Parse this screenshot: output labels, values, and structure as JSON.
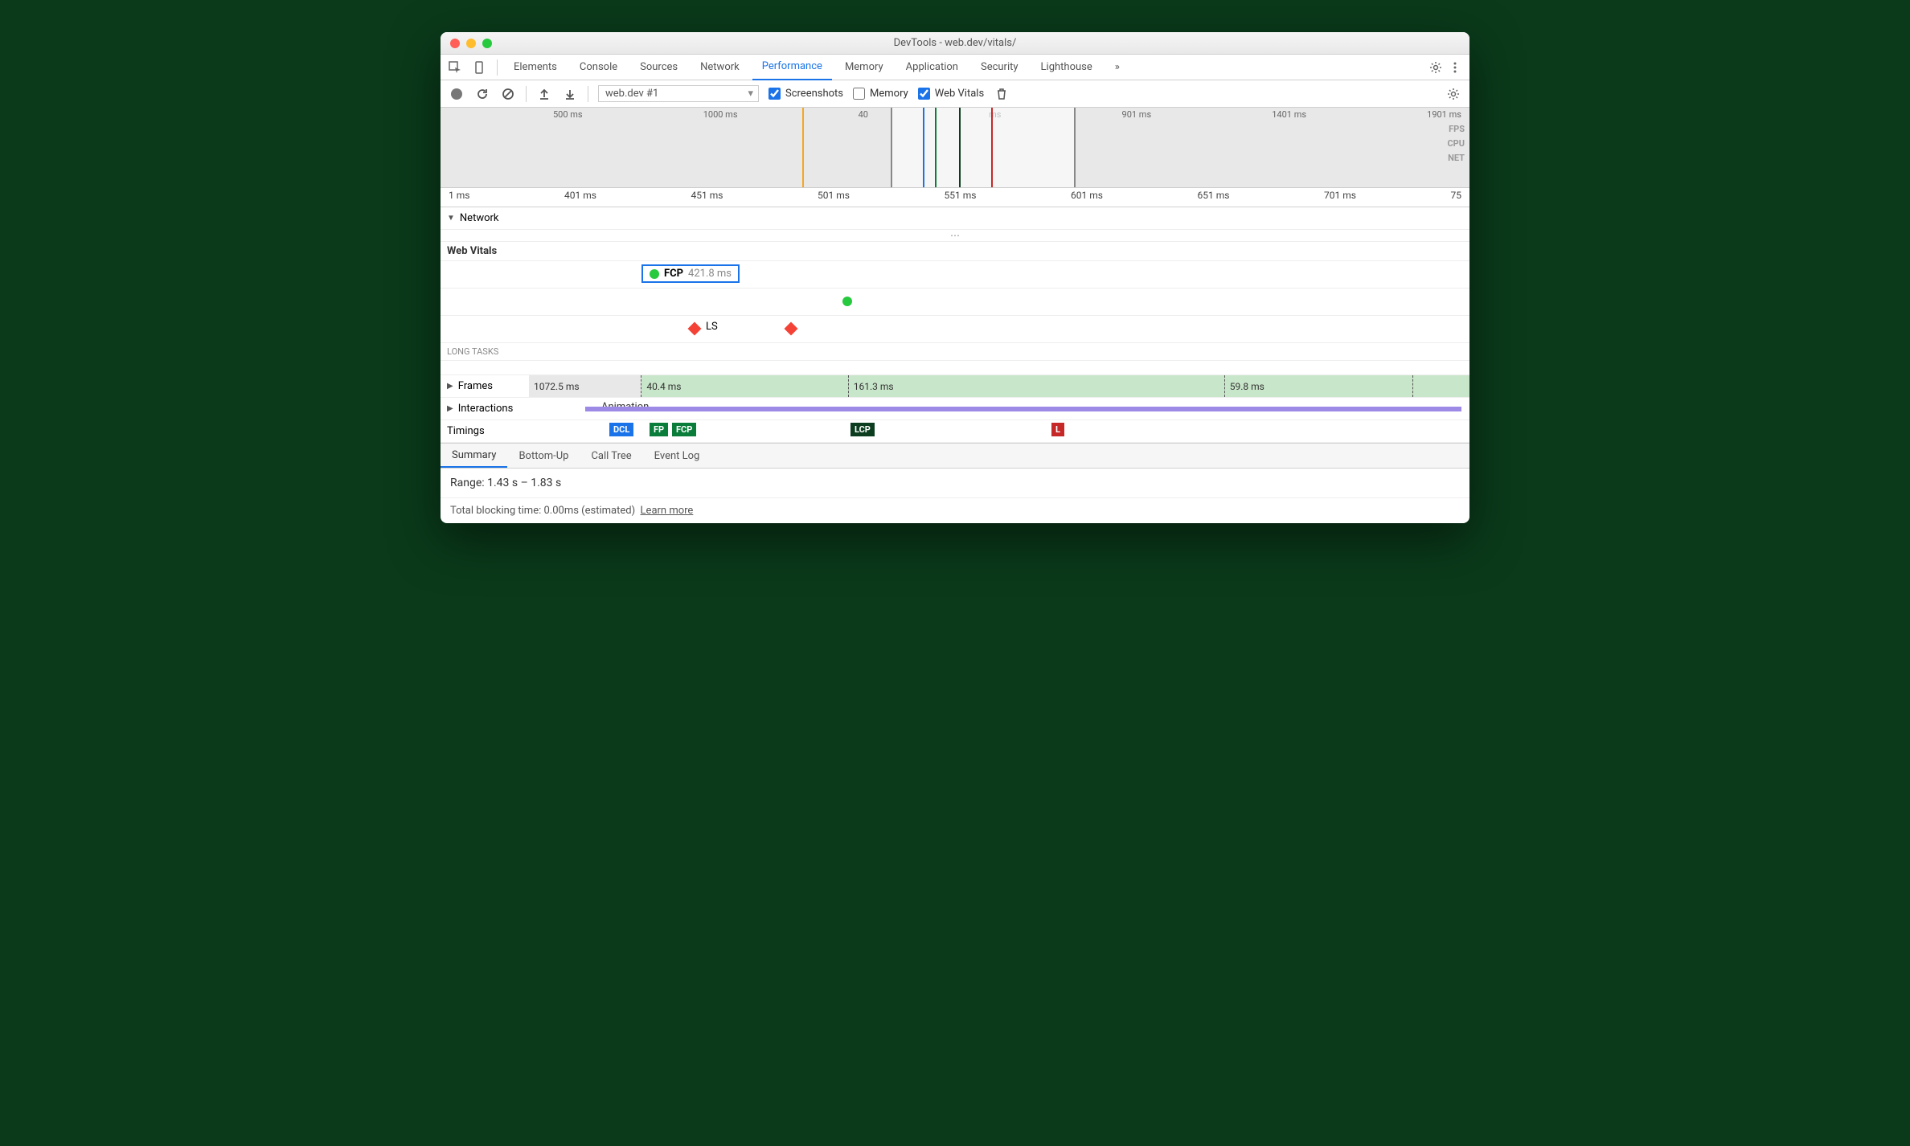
{
  "window": {
    "title": "DevTools - web.dev/vitals/"
  },
  "tabs": {
    "items": [
      "Elements",
      "Console",
      "Sources",
      "Network",
      "Performance",
      "Memory",
      "Application",
      "Security",
      "Lighthouse"
    ],
    "active": "Performance",
    "more": "»"
  },
  "toolbar": {
    "profile": "web.dev #1",
    "screenshots_label": "Screenshots",
    "screenshots_checked": true,
    "memory_label": "Memory",
    "memory_checked": false,
    "webvitals_label": "Web Vitals",
    "webvitals_checked": true
  },
  "overview": {
    "ticks": [
      "500 ms",
      "1000 ms",
      "40",
      "ms",
      "901 ms",
      "1401 ms",
      "1901 ms"
    ],
    "labels": [
      "FPS",
      "CPU",
      "NET"
    ]
  },
  "ruler": {
    "ticks": [
      "1 ms",
      "401 ms",
      "451 ms",
      "501 ms",
      "551 ms",
      "601 ms",
      "651 ms",
      "701 ms",
      "75"
    ]
  },
  "sections": {
    "network": "Network",
    "webvitals": "Web Vitals",
    "longtasks": "LONG TASKS",
    "frames": "Frames",
    "interactions": "Interactions",
    "timings": "Timings",
    "animation": "Animation"
  },
  "webvitals": {
    "fcp_label": "FCP",
    "fcp_value": "421.8 ms",
    "fcp_color": "#27c93f",
    "ls_label": "LS",
    "ls_color": "#f44336"
  },
  "frames": {
    "segments": [
      "1072.5 ms",
      "40.4 ms",
      "161.3 ms",
      "59.8 ms"
    ]
  },
  "timings": {
    "dcl": {
      "label": "DCL",
      "color": "#1a73e8"
    },
    "fp": {
      "label": "FP",
      "color": "#0a7d3a"
    },
    "fcp": {
      "label": "FCP",
      "color": "#0a7d3a"
    },
    "lcp": {
      "label": "LCP",
      "color": "#0b3d1e"
    },
    "l": {
      "label": "L",
      "color": "#c62828"
    }
  },
  "detail_tabs": {
    "items": [
      "Summary",
      "Bottom-Up",
      "Call Tree",
      "Event Log"
    ],
    "active": "Summary"
  },
  "summary": {
    "range": "Range: 1.43 s – 1.83 s"
  },
  "footer": {
    "tbt": "Total blocking time: 0.00ms (estimated)",
    "learn": "Learn more"
  }
}
